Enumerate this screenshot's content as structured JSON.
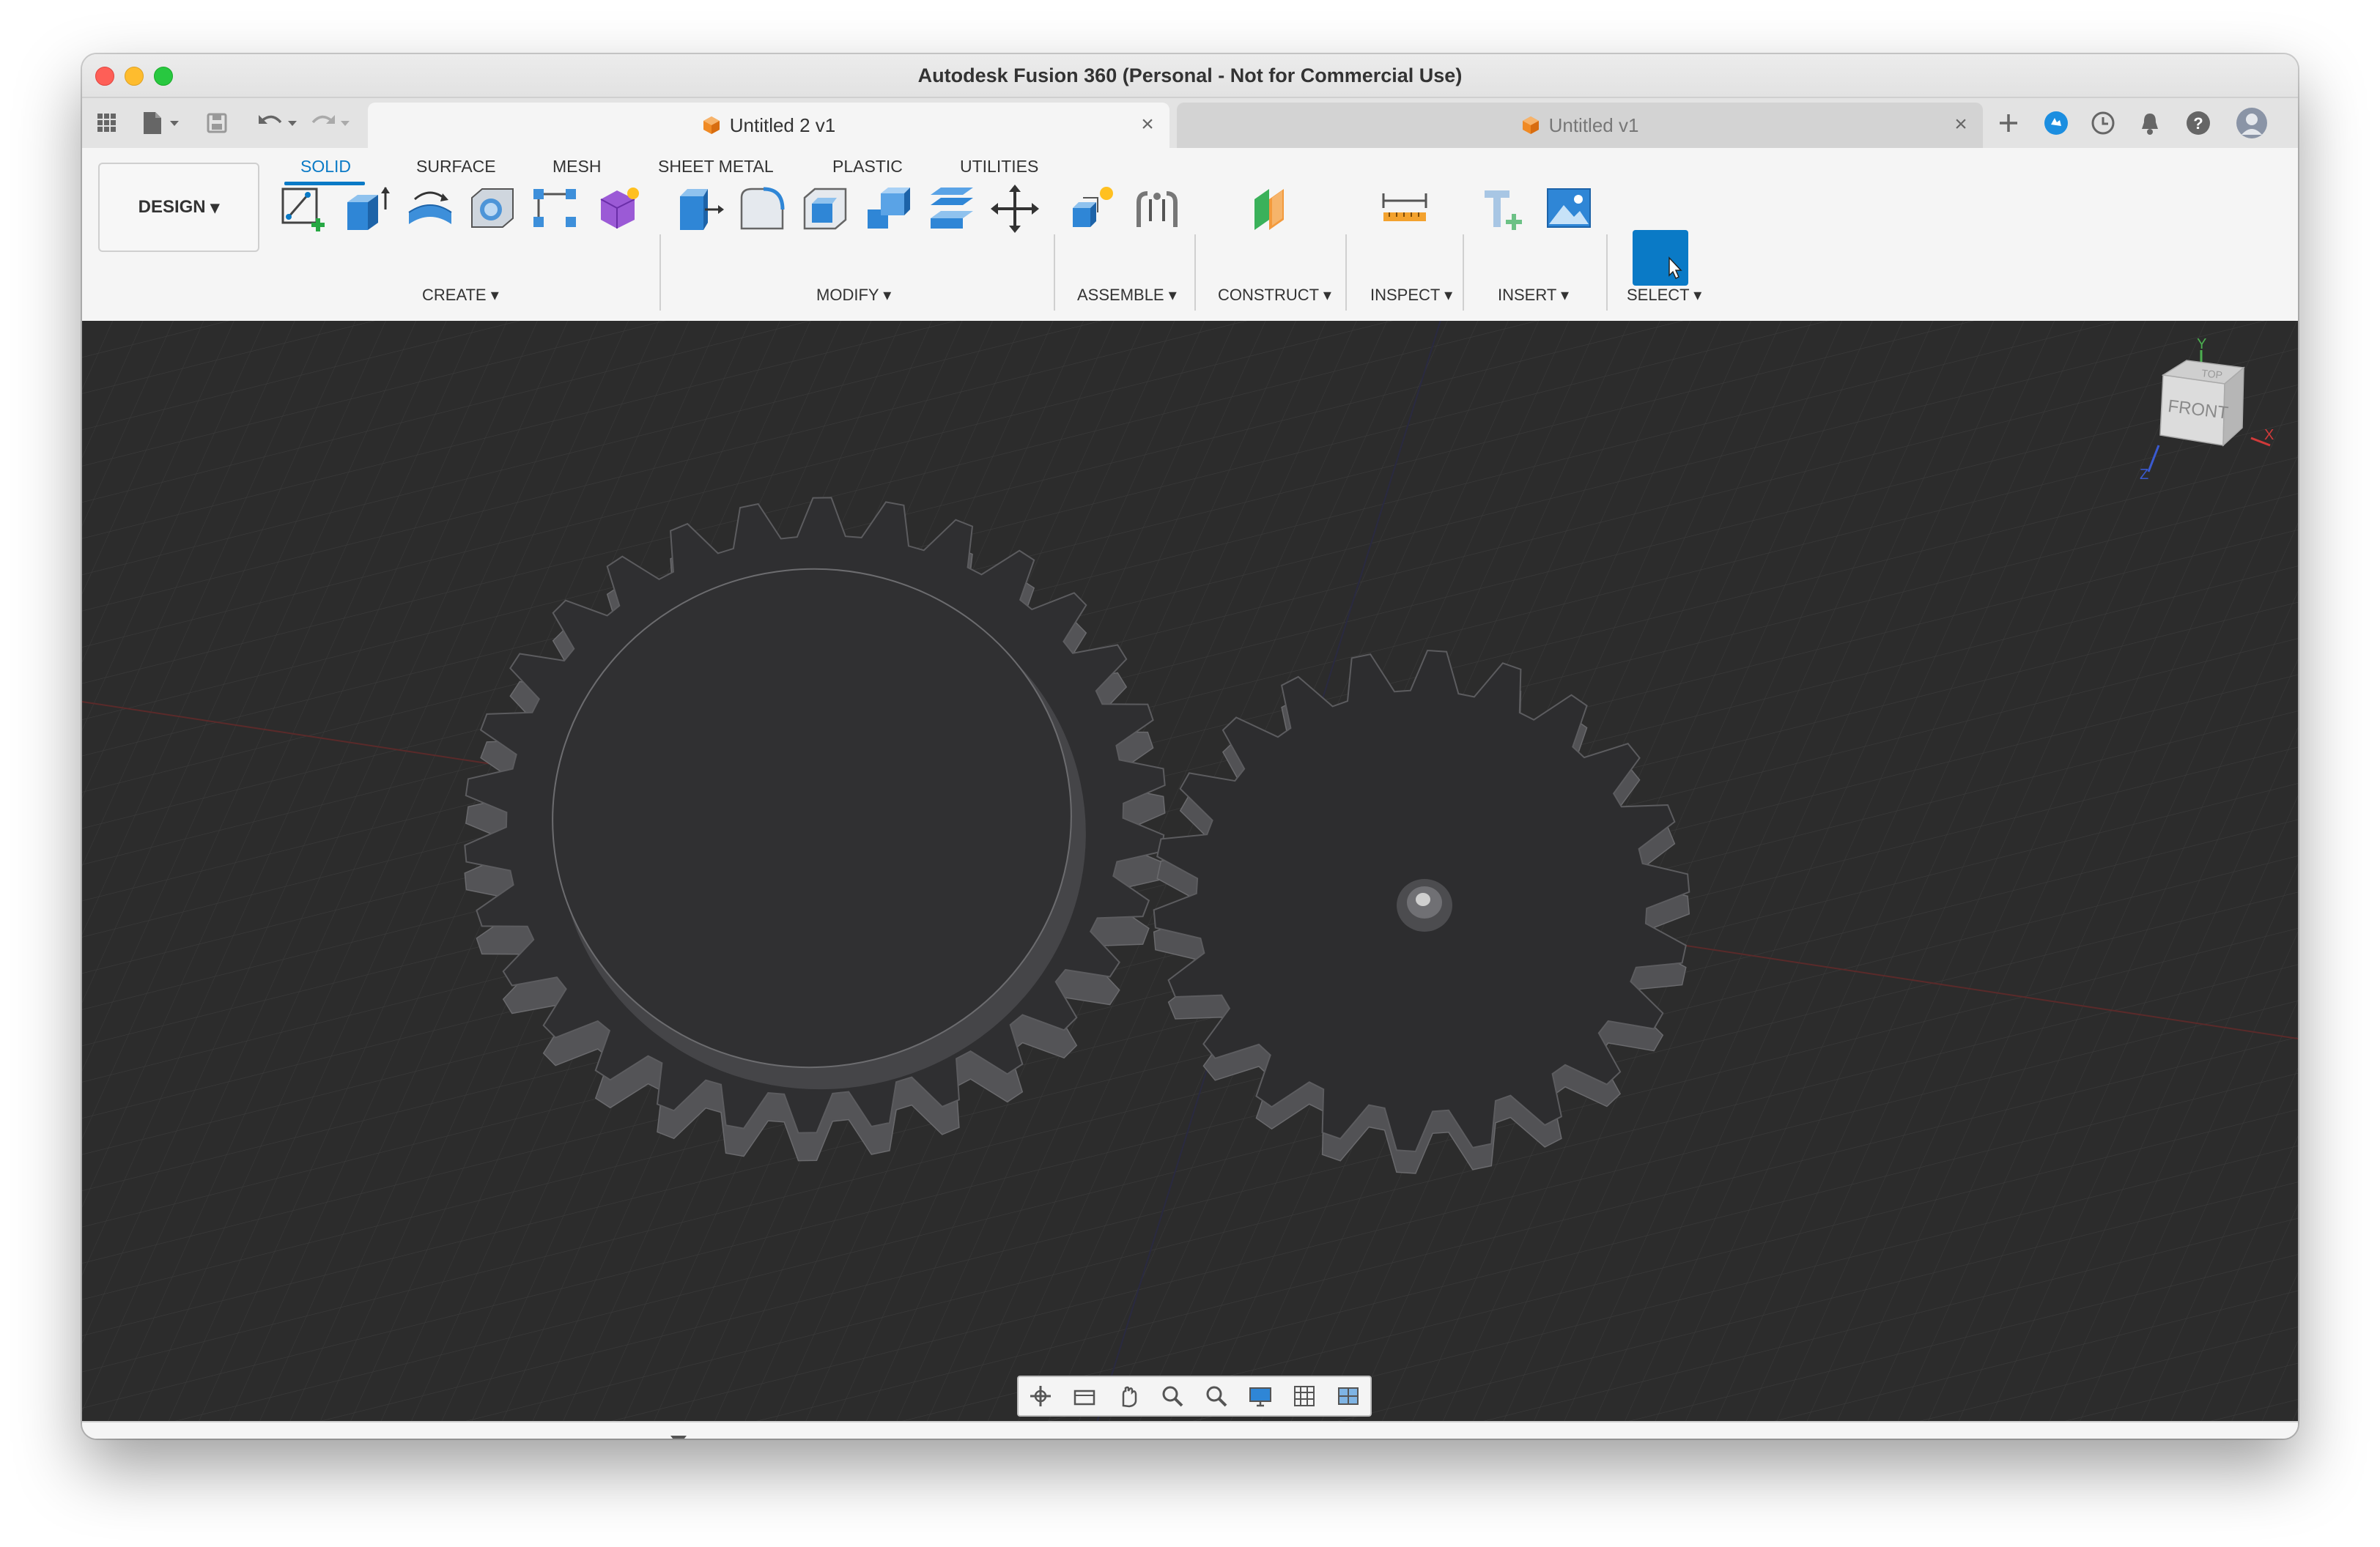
{
  "window": {
    "title": "Autodesk Fusion 360 (Personal - Not for Commercial Use)"
  },
  "tabs": [
    {
      "label": "Untitled 2 v1",
      "active": true
    },
    {
      "label": "Untitled v1",
      "active": false
    }
  ],
  "toolbar": {
    "workspace": "DESIGN",
    "tabs": [
      "SOLID",
      "SURFACE",
      "MESH",
      "SHEET METAL",
      "PLASTIC",
      "UTILITIES"
    ],
    "selected_tab": "SOLID",
    "groups": [
      "CREATE",
      "MODIFY",
      "ASSEMBLE",
      "CONSTRUCT",
      "INSPECT",
      "INSERT",
      "SELECT"
    ]
  },
  "viewcube": {
    "face_front": "FRONT",
    "face_top": "TOP",
    "axis_x": "X",
    "axis_y": "Y",
    "axis_z": "Z"
  },
  "colors": {
    "accent": "#0a7ac6",
    "viewport_bg": "#2c2c2c",
    "gear_face": "#2e2e30",
    "gear_side": "#565659"
  },
  "icons": {
    "toolbar_left": [
      "apps-grid-icon",
      "file-icon",
      "save-icon",
      "undo-icon",
      "redo-icon"
    ],
    "toolbar_right": [
      "new-tab-icon",
      "extensions-icon",
      "job-status-icon",
      "notifications-icon",
      "help-icon",
      "user-avatar-icon"
    ],
    "nav_bar": [
      "orbit-icon",
      "look-at-icon",
      "pan-icon",
      "zoom-icon",
      "zoom-window-icon",
      "display-settings-icon",
      "grid-settings-icon",
      "viewports-icon"
    ],
    "timeline": [
      "skip-start-icon",
      "step-back-icon",
      "play-icon",
      "step-forward-icon",
      "skip-end-icon",
      "settings-gear-icon"
    ]
  }
}
